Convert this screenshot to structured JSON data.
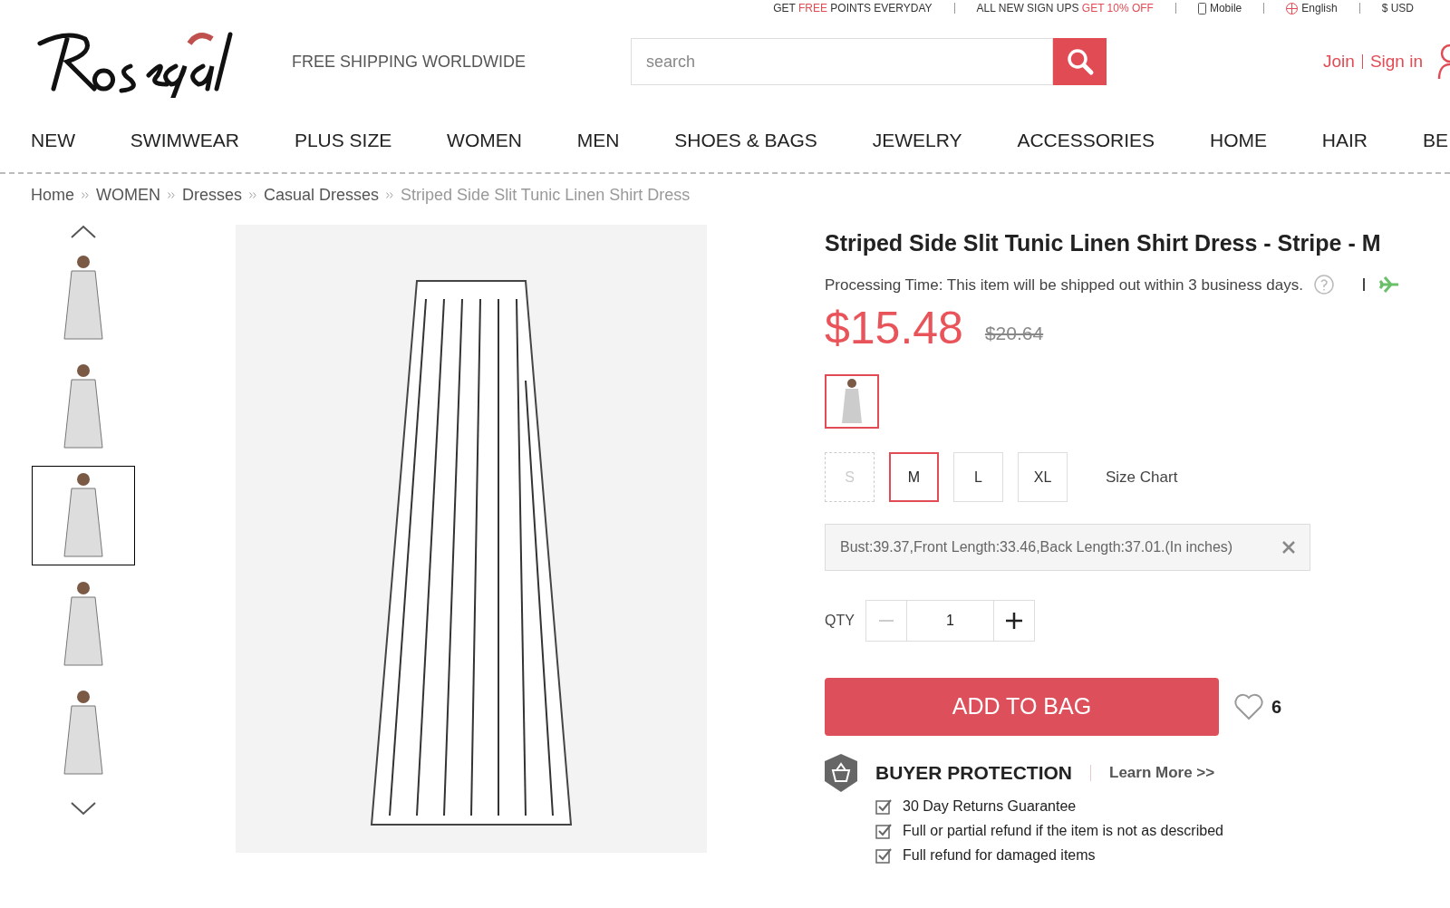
{
  "top_bar": [
    {
      "parts": [
        {
          "text": "GET ",
          "accent": false
        },
        {
          "text": "FREE",
          "accent": true
        },
        {
          "text": " POINTS EVERYDAY",
          "accent": false
        }
      ]
    },
    {
      "parts": [
        {
          "text": "ALL NEW SIGN UPS ",
          "accent": false
        },
        {
          "text": "GET 10% OFF",
          "accent": true
        }
      ]
    },
    {
      "parts": [
        {
          "text": "Mobile",
          "accent": false
        }
      ],
      "kind": "mobile"
    },
    {
      "parts": [
        {
          "text": "English",
          "accent": false
        }
      ],
      "kind": "language"
    },
    {
      "parts": [
        {
          "text": "$ USD",
          "accent": false
        }
      ]
    }
  ],
  "header": {
    "tagline": "FREE SHIPPING WORLDWIDE",
    "search": {
      "placeholder": "search"
    },
    "account": [
      "Join",
      "Sign in"
    ]
  },
  "nav": [
    "NEW",
    "SWIMWEAR",
    "PLUS SIZE",
    "WOMEN",
    "MEN",
    "SHOES & BAGS",
    "JEWELRY",
    "ACCESSORIES",
    "HOME",
    "HAIR",
    "BE"
  ],
  "breadcrumb": [
    {
      "label": "Home",
      "current": false
    },
    {
      "label": "WOMEN",
      "current": false
    },
    {
      "label": "Dresses",
      "current": false
    },
    {
      "label": "Casual Dresses",
      "current": false
    },
    {
      "label": "Striped Side Slit Tunic Linen Shirt Dress",
      "current": true
    }
  ],
  "thumbnails": [
    {
      "selected": false
    },
    {
      "selected": false
    },
    {
      "selected": true
    },
    {
      "selected": false
    },
    {
      "selected": false
    }
  ],
  "product": {
    "title": "Striped Side Slit Tunic Linen Shirt Dress - Stripe - M",
    "processing": "Processing Time: This item will be shipped out within 3 business days.",
    "price": "$15.48",
    "old_price": "$20.64",
    "colors": [
      {
        "selected": true
      }
    ],
    "sizes": [
      {
        "label": "S",
        "selected": false,
        "disabled": true
      },
      {
        "label": "M",
        "selected": true,
        "disabled": false
      },
      {
        "label": "L",
        "selected": false,
        "disabled": false
      },
      {
        "label": "XL",
        "selected": false,
        "disabled": false
      }
    ],
    "size_chart": "Size Chart",
    "measurements": "Bust:39.37,Front Length:33.46,Back Length:37.01.(In inches)",
    "qty_label": "QTY",
    "qty": "1",
    "add_to_bag": "ADD TO BAG",
    "likes": "6",
    "protection": {
      "title": "BUYER PROTECTION",
      "link": "Learn More >>",
      "items": [
        "30 Day Returns Guarantee",
        "Full or partial refund if the item is not as described",
        "Full refund for damaged items"
      ]
    }
  }
}
